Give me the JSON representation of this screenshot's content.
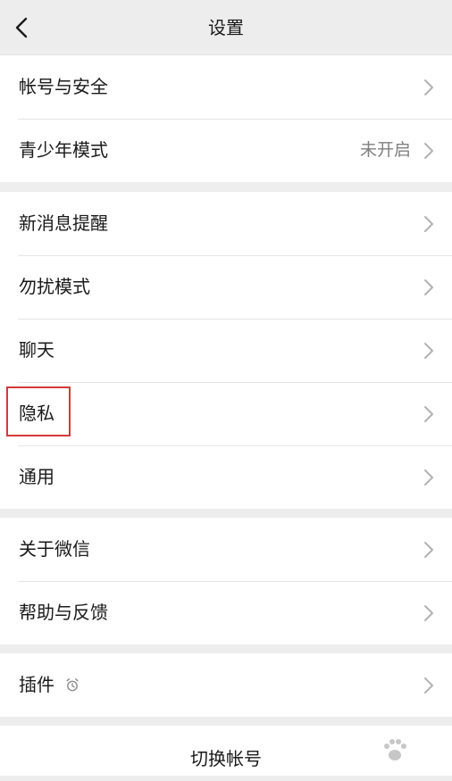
{
  "navbar": {
    "title": "设置"
  },
  "groups": [
    {
      "items": [
        {
          "label": "帐号与安全",
          "value": ""
        },
        {
          "label": "青少年模式",
          "value": "未开启"
        }
      ]
    },
    {
      "items": [
        {
          "label": "新消息提醒",
          "value": ""
        },
        {
          "label": "勿扰模式",
          "value": ""
        },
        {
          "label": "聊天",
          "value": ""
        },
        {
          "label": "隐私",
          "value": ""
        },
        {
          "label": "通用",
          "value": ""
        }
      ]
    },
    {
      "items": [
        {
          "label": "关于微信",
          "value": ""
        },
        {
          "label": "帮助与反馈",
          "value": ""
        }
      ]
    },
    {
      "items": [
        {
          "label": "插件",
          "value": ""
        }
      ]
    }
  ],
  "switch_account": {
    "label": "切换帐号"
  },
  "colors": {
    "background": "#ededed",
    "cell": "#ffffff",
    "text": "#1a1a1a",
    "secondary_text": "#7f7f7f",
    "chevron": "#b2b2b2",
    "highlight": "#d4383b"
  },
  "icons": {
    "back": "back-chevron-icon",
    "row_arrow": "chevron-right-icon",
    "plugin_badge": "alarm-clock-icon"
  }
}
